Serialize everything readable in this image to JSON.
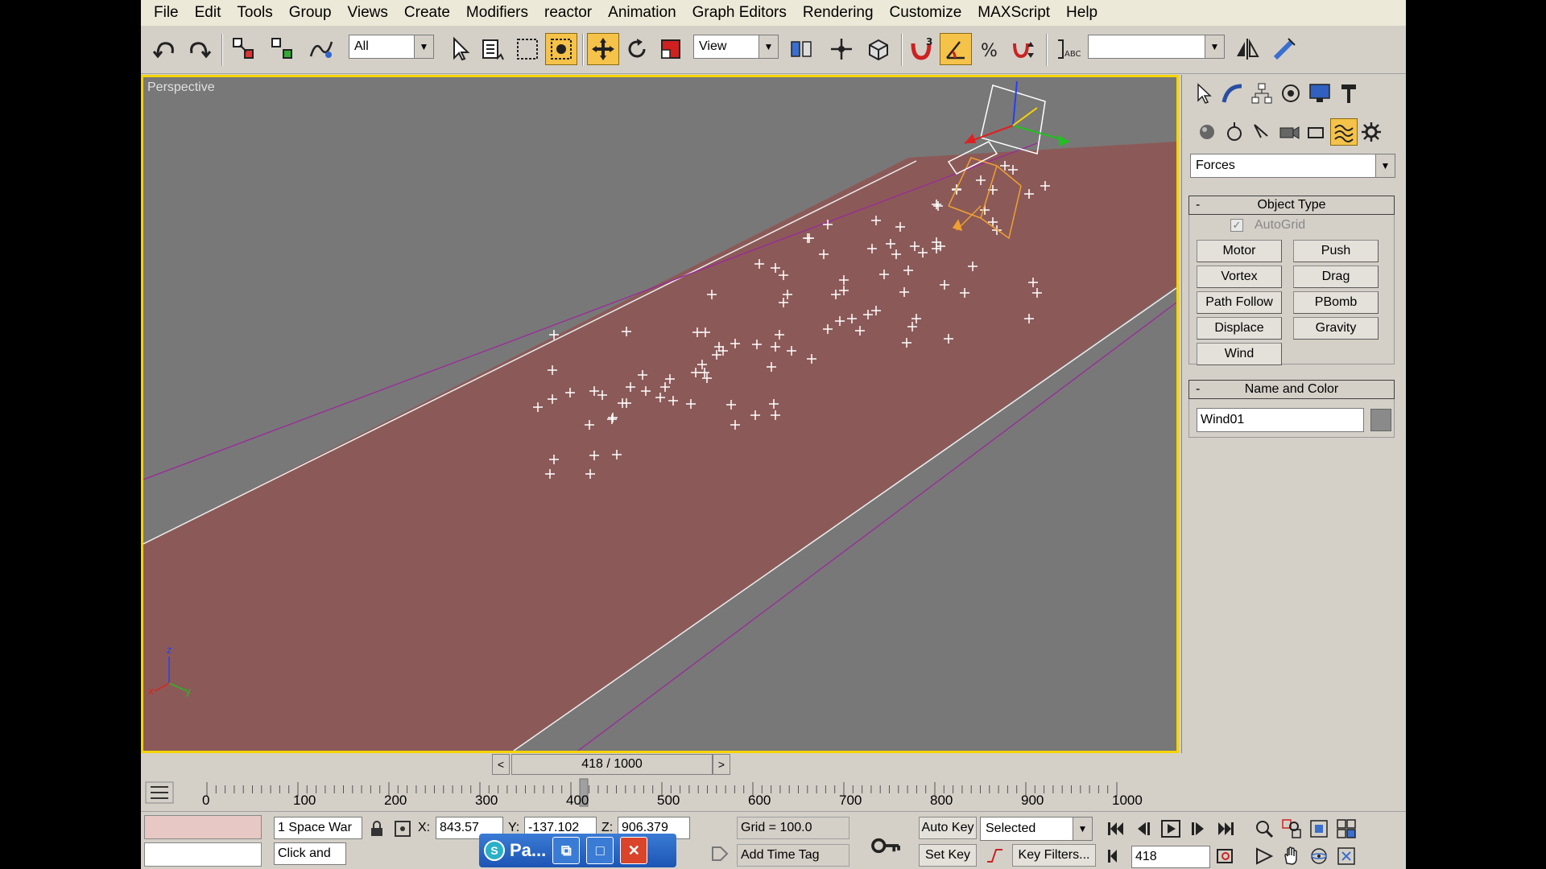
{
  "menu": [
    "File",
    "Edit",
    "Tools",
    "Group",
    "Views",
    "Create",
    "Modifiers",
    "reactor",
    "Animation",
    "Graph Editors",
    "Rendering",
    "Customize",
    "MAXScript",
    "Help"
  ],
  "toolbar": {
    "selection_filter": "All",
    "ref_coord": "View",
    "named_sel": ""
  },
  "viewport": {
    "label": "Perspective",
    "axis_x": "x",
    "axis_y": "y",
    "axis_z": "z"
  },
  "command_panel": {
    "category": "Forces",
    "object_type_title": "Object Type",
    "autogrid_label": "AutoGrid",
    "autogrid_mark": "✓",
    "buttons": [
      "Motor",
      "Push",
      "Vortex",
      "Drag",
      "Path Follow",
      "PBomb",
      "Displace",
      "Gravity",
      "Wind"
    ],
    "name_color_title": "Name and Color",
    "object_name": "Wind01",
    "rollout_minus": "-"
  },
  "time_slider": {
    "label": "418 / 1000",
    "prev": "<",
    "next": ">"
  },
  "trackbar": {
    "ticks": [
      "0",
      "100",
      "200",
      "300",
      "400",
      "500",
      "600",
      "700",
      "800",
      "900",
      "1000"
    ]
  },
  "status": {
    "selection_count": "1 Space War",
    "prompt": "Click and",
    "x_label": "X:",
    "x_value": "843.57",
    "y_label": "Y:",
    "y_value": "-137.102",
    "z_label": "Z:",
    "z_value": "906.379",
    "grid": "Grid = 100.0",
    "add_time_tag": "Add Time Tag",
    "auto_key": "Auto Key",
    "set_key": "Set Key",
    "key_mode": "Selected",
    "key_filters": "Key Filters...",
    "current_frame": "418"
  },
  "taskbar_button": {
    "label": "Pa...",
    "app_glyph": "S",
    "restore_glyph": "⧉",
    "maximize_glyph": "□",
    "close_glyph": "✕"
  },
  "colors": {
    "viewport_bg": "#787878",
    "plane_fill": "#8b5a58",
    "active_border": "#f5d400",
    "panel_bg": "#d4d0c8",
    "active_button": "#f5c24a"
  }
}
